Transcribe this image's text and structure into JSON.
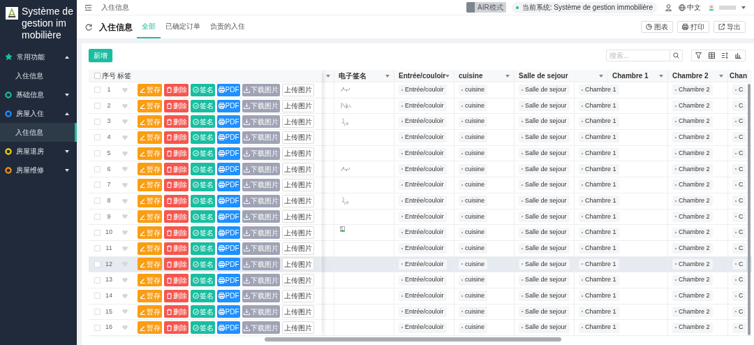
{
  "sidebar": {
    "title": "Système de gestion immobilière",
    "items": [
      {
        "label": "常用功能",
        "kind": "star",
        "color": "#19bea0",
        "expanded": true,
        "children": [
          {
            "label": "入住信息",
            "selected": false
          }
        ]
      },
      {
        "label": "基础信息",
        "kind": "circle",
        "color": "#19bea0",
        "expanded": false
      },
      {
        "label": "房屋入住",
        "kind": "circle",
        "color": "#1e90ff",
        "expanded": true,
        "children": [
          {
            "label": "入住信息",
            "selected": true
          }
        ]
      },
      {
        "label": "房屋退房",
        "kind": "circle",
        "color": "#f5d90a",
        "expanded": false
      },
      {
        "label": "房屋维修",
        "kind": "circle",
        "color": "#f7941d",
        "expanded": false
      }
    ]
  },
  "header": {
    "breadcrumb": "入住信息",
    "mode": {
      "label": "AIR模式",
      "on": false
    },
    "system": "当前系统: Système de gestion immobilière",
    "language": "中文"
  },
  "page": {
    "title": "入住信息",
    "tabs": [
      {
        "label": "全部",
        "selected": true
      },
      {
        "label": "已确定订单",
        "selected": false
      },
      {
        "label": "负责的入住",
        "selected": false
      }
    ],
    "buttons": [
      "图表",
      "打印",
      "导出"
    ]
  },
  "toolbar": {
    "add_button": "新增",
    "search": {
      "placeholder": "搜索..."
    }
  },
  "table": {
    "all_selected": false,
    "columns": [
      "序号",
      "标签",
      "电子签名",
      "Entrée/couloir",
      "cuisine",
      "Salle de sejour",
      "Chambre 1",
      "Chambre 2",
      "Chan"
    ],
    "rows": [
      {
        "number": "1",
        "selected": false,
        "highlighted": false,
        "favorite": false,
        "signature": {
          "kind": "handwriting"
        },
        "actions": [
          "暂存",
          "删除",
          "签名",
          "PDF",
          "下载图片",
          "上传图片"
        ],
        "tags": [
          "Entrée/couloir",
          "cuisine",
          "Salle de sejour",
          "Chambre 1",
          "Chambre 2",
          "C"
        ]
      },
      {
        "number": "2",
        "selected": false,
        "highlighted": false,
        "favorite": false,
        "signature": {
          "kind": "handwriting"
        },
        "actions": [
          "暂存",
          "删除",
          "签名",
          "PDF",
          "下载图片",
          "上传图片"
        ],
        "tags": [
          "Entrée/couloir",
          "cuisine",
          "Salle de sejour",
          "Chambre 1",
          "Chambre 2",
          "C"
        ]
      },
      {
        "number": "3",
        "selected": false,
        "highlighted": false,
        "favorite": false,
        "signature": {
          "kind": "handwriting"
        },
        "actions": [
          "暂存",
          "删除",
          "签名",
          "PDF",
          "下载图片",
          "上传图片"
        ],
        "tags": [
          "Entrée/couloir",
          "cuisine",
          "Salle de sejour",
          "Chambre 1",
          "Chambre 2",
          "C"
        ]
      },
      {
        "number": "4",
        "selected": false,
        "highlighted": false,
        "favorite": false,
        "actions": [
          "暂存",
          "删除",
          "签名",
          "PDF",
          "下载图片",
          "上传图片"
        ],
        "tags": [
          "Entrée/couloir",
          "cuisine",
          "Salle de sejour",
          "Chambre 1",
          "Chambre 2",
          "C"
        ]
      },
      {
        "number": "5",
        "selected": false,
        "highlighted": false,
        "favorite": false,
        "actions": [
          "暂存",
          "删除",
          "签名",
          "PDF",
          "下载图片",
          "上传图片"
        ],
        "tags": [
          "Entrée/couloir",
          "cuisine",
          "Salle de sejour",
          "Chambre 1",
          "Chambre 2",
          "C"
        ]
      },
      {
        "number": "6",
        "selected": false,
        "highlighted": false,
        "favorite": false,
        "signature": {
          "kind": "handwriting"
        },
        "actions": [
          "暂存",
          "删除",
          "签名",
          "PDF",
          "下载图片",
          "上传图片"
        ],
        "tags": [
          "Entrée/couloir",
          "cuisine",
          "Salle de sejour",
          "Chambre 1",
          "Chambre 2",
          "C"
        ]
      },
      {
        "number": "7",
        "selected": false,
        "highlighted": false,
        "favorite": false,
        "actions": [
          "暂存",
          "删除",
          "签名",
          "PDF",
          "下载图片",
          "上传图片"
        ],
        "tags": [
          "Entrée/couloir",
          "cuisine",
          "Salle de sejour",
          "Chambre 1",
          "Chambre 2",
          "C"
        ]
      },
      {
        "number": "8",
        "selected": false,
        "highlighted": false,
        "favorite": false,
        "signature": {
          "kind": "handwriting"
        },
        "actions": [
          "暂存",
          "删除",
          "签名",
          "PDF",
          "下载图片",
          "上传图片"
        ],
        "tags": [
          "Entrée/couloir",
          "cuisine",
          "Salle de sejour",
          "Chambre 1",
          "Chambre 2",
          "C"
        ]
      },
      {
        "number": "9",
        "selected": false,
        "highlighted": false,
        "favorite": false,
        "actions": [
          "暂存",
          "删除",
          "签名",
          "PDF",
          "下载图片",
          "上传图片"
        ],
        "tags": [
          "Entrée/couloir",
          "cuisine",
          "Salle de sejour",
          "Chambre 1",
          "Chambre 2",
          "C"
        ]
      },
      {
        "number": "10",
        "selected": false,
        "highlighted": false,
        "favorite": false,
        "signature": {
          "kind": "broken"
        },
        "actions": [
          "暂存",
          "删除",
          "签名",
          "PDF",
          "下载图片",
          "上传图片"
        ],
        "tags": [
          "Entrée/couloir",
          "cuisine",
          "Salle de sejour",
          "Chambre 1",
          "Chambre 2",
          "C"
        ]
      },
      {
        "number": "11",
        "selected": false,
        "highlighted": false,
        "favorite": false,
        "actions": [
          "暂存",
          "删除",
          "签名",
          "PDF",
          "下载图片",
          "上传图片"
        ],
        "tags": [
          "Entrée/couloir",
          "cuisine",
          "Salle de sejour",
          "Chambre 1",
          "Chambre 2",
          "C"
        ]
      },
      {
        "number": "12",
        "selected": false,
        "highlighted": true,
        "favorite": false,
        "actions": [
          "暂存",
          "删除",
          "签名",
          "PDF",
          "下载图片",
          "上传图片"
        ],
        "tags": [
          "Entrée/couloir",
          "cuisine",
          "Salle de sejour",
          "Chambre 1",
          "Chambre 2",
          "C"
        ]
      },
      {
        "number": "13",
        "selected": false,
        "highlighted": false,
        "favorite": false,
        "actions": [
          "暂存",
          "删除",
          "签名",
          "PDF",
          "下载图片",
          "上传图片"
        ],
        "tags": [
          "Entrée/couloir",
          "cuisine",
          "Salle de sejour",
          "Chambre 1",
          "Chambre 2",
          "C"
        ]
      },
      {
        "number": "14",
        "selected": false,
        "highlighted": false,
        "favorite": false,
        "actions": [
          "暂存",
          "删除",
          "签名",
          "PDF",
          "下载图片",
          "上传图片"
        ],
        "tags": [
          "Entrée/couloir",
          "cuisine",
          "Salle de sejour",
          "Chambre 1",
          "Chambre 2",
          "C"
        ]
      },
      {
        "number": "15",
        "selected": false,
        "highlighted": false,
        "favorite": false,
        "actions": [
          "暂存",
          "删除",
          "签名",
          "PDF",
          "下载图片",
          "上传图片"
        ],
        "tags": [
          "Entrée/couloir",
          "cuisine",
          "Salle de sejour",
          "Chambre 1",
          "Chambre 2",
          "C"
        ]
      },
      {
        "number": "16",
        "selected": false,
        "highlighted": false,
        "favorite": false,
        "actions": [
          "暂存",
          "删除",
          "签名",
          "PDF",
          "下载图片",
          "上传图片"
        ],
        "tags": [
          "Entrée/couloir",
          "cuisine",
          "Salle de sejour",
          "Chambre 1",
          "Chambre 2",
          "C"
        ]
      }
    ]
  }
}
